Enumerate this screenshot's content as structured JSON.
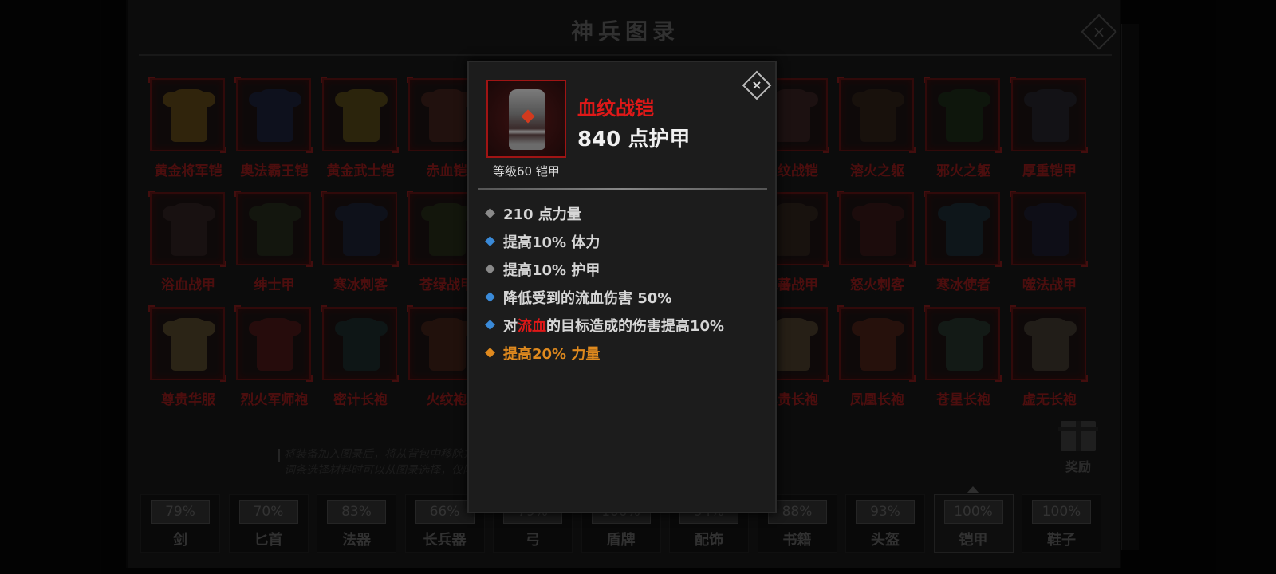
{
  "panel": {
    "title": "神兵图录",
    "close_icon": "×"
  },
  "grid": {
    "rows": [
      [
        "黄金将军铠",
        "奥法霸王铠",
        "黄金武士铠",
        "赤血铠",
        "血纹战铠",
        "溶火之躯",
        "邪火之躯",
        "厚重铠甲"
      ],
      [
        "浴血战甲",
        "绅士甲",
        "寒冰刺客",
        "苍绿战甲",
        "铠蕃战甲",
        "怒火刺客",
        "寒冰使者",
        "噬法战甲"
      ],
      [
        "尊贵华服",
        "烈火军师袍",
        "密计长袍",
        "火纹袍",
        "尊贵长袍",
        "凤凰长袍",
        "苍星长袍",
        "虚无长袍"
      ]
    ],
    "armor_colors": [
      [
        "#8a6a1c",
        "#1c2a55",
        "#7a6a1c",
        "#5a2a22",
        "#4a2a2a",
        "#3a2a1c",
        "#1c3a1c",
        "#2a2e3a"
      ],
      [
        "#3a2a2a",
        "#2a3a22",
        "#1c2a4a",
        "#2a3a1c",
        "#3a2e24",
        "#4a1c1c",
        "#1c3a4a",
        "#1c2440"
      ],
      [
        "#7a6a3a",
        "#6a1c1c",
        "#1c3a3a",
        "#5a2a1c",
        "#6a5a3a",
        "#6a2a1c",
        "#2a4a3a",
        "#5a5244"
      ]
    ]
  },
  "info_text": "将装备加入图录后，将从背包中移除并可获得部分锻造材料提炼词条选择材料时可以从图录选择，仅限每日一次。",
  "reward": {
    "label": "奖励"
  },
  "tabs": [
    {
      "label": "剑",
      "percent": "79%"
    },
    {
      "label": "匕首",
      "percent": "70%"
    },
    {
      "label": "法器",
      "percent": "83%"
    },
    {
      "label": "长兵器",
      "percent": "66%"
    },
    {
      "label": "弓",
      "percent": "79%"
    },
    {
      "label": "盾牌",
      "percent": "100%"
    },
    {
      "label": "配饰",
      "percent": "94%"
    },
    {
      "label": "书籍",
      "percent": "88%"
    },
    {
      "label": "头盔",
      "percent": "93%"
    },
    {
      "label": "铠甲",
      "percent": "100%"
    },
    {
      "label": "鞋子",
      "percent": "100%"
    }
  ],
  "active_tab": "铠甲",
  "tooltip": {
    "name": "血纹战铠",
    "armor_value": "840 点护甲",
    "subtitle": "等级60 铠甲",
    "close_icon": "×",
    "name_color": "#e01818",
    "stats": [
      {
        "text": "210 点力量",
        "bullet_color": "#8a8a8a",
        "text_color": "#d6d6d6"
      },
      {
        "text": "提高10% 体力",
        "bullet_color": "#3a8ad8",
        "text_color": "#d6d6d6"
      },
      {
        "text": "提高10% 护甲",
        "bullet_color": "#8a8a8a",
        "text_color": "#d6d6d6"
      },
      {
        "text": "降低受到的流血伤害 50%",
        "bullet_color": "#3a8ad8",
        "text_color": "#d6d6d6"
      },
      {
        "text_pre": "对",
        "text_hl": "流血",
        "text_post": "的目标造成的伤害提高10%",
        "bullet_color": "#3a8ad8",
        "text_color": "#d6d6d6"
      },
      {
        "text": "提高20% 力量",
        "bullet_color": "#e08a1e",
        "text_color": "#e08a1e"
      }
    ]
  }
}
